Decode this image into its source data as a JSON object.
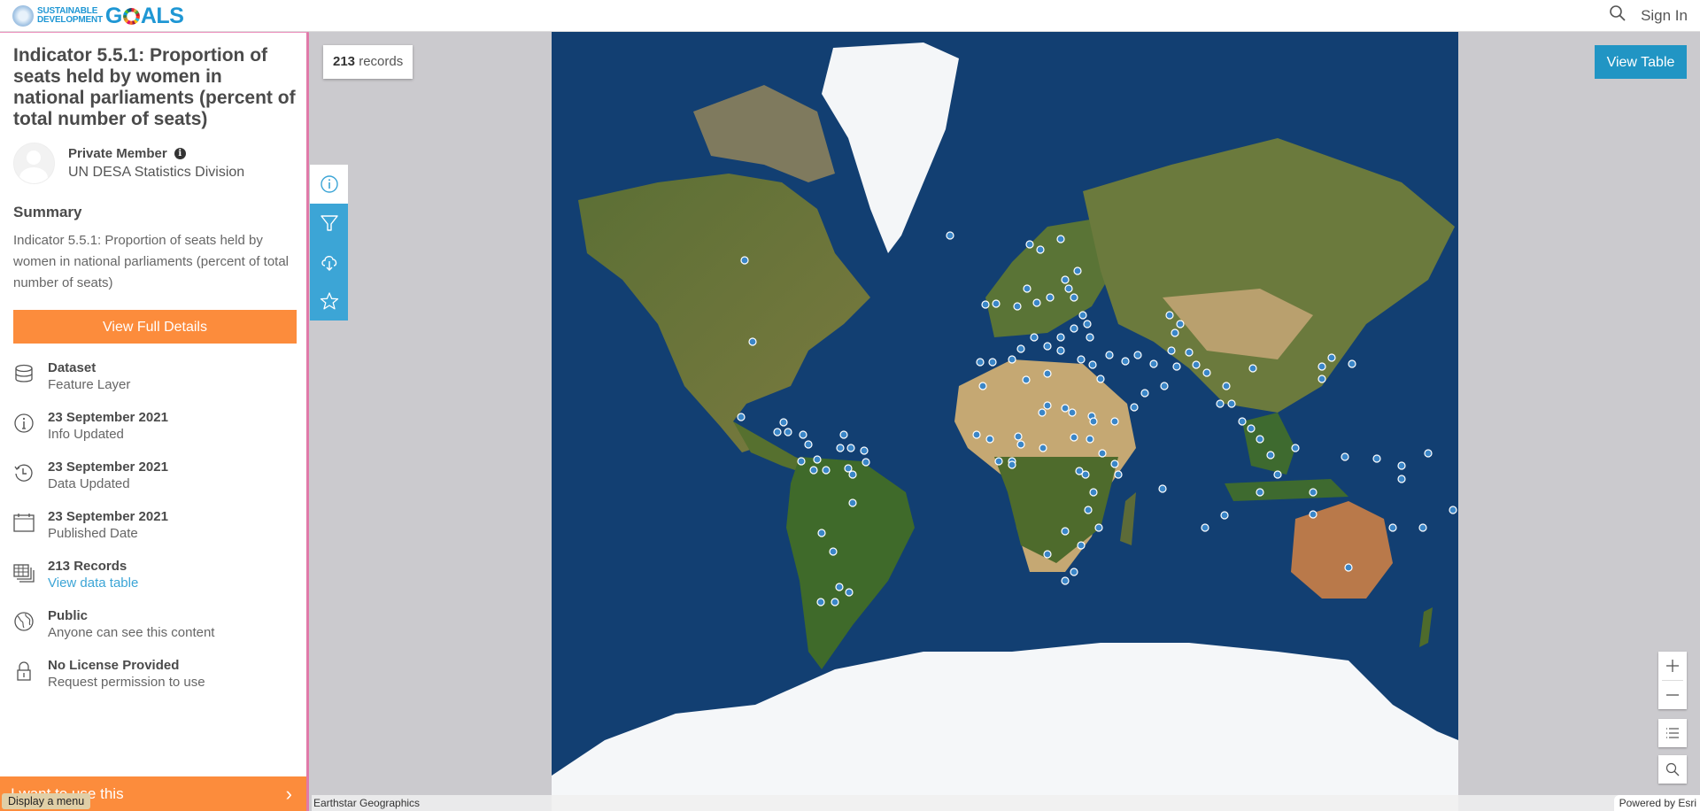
{
  "header": {
    "logo_small_line1": "SUSTAINABLE",
    "logo_small_line2": "DEVELOPMENT",
    "logo_goals_g": "G",
    "logo_goals_rest": "ALS",
    "search_icon": "search-icon",
    "sign_in": "Sign In"
  },
  "panel": {
    "title": "Indicator 5.5.1: Proportion of seats held by women in national parliaments (percent of total number of seats)",
    "owner_name": "Private Member",
    "owner_info_glyph": "i",
    "owner_org": "UN DESA Statistics Division",
    "summary_heading": "Summary",
    "summary_text": "Indicator 5.5.1: Proportion of seats held by women in national parliaments (percent of total number of seats)",
    "details_button": "View Full Details",
    "meta": [
      {
        "icon": "database-icon",
        "title": "Dataset",
        "sub": "Feature Layer"
      },
      {
        "icon": "info-icon",
        "title": "23 September 2021",
        "sub": "Info Updated"
      },
      {
        "icon": "history-icon",
        "title": "23 September 2021",
        "sub": "Data Updated"
      },
      {
        "icon": "calendar-icon",
        "title": "23 September 2021",
        "sub": "Published Date"
      },
      {
        "icon": "table-icon",
        "title": "213 Records",
        "link": "View data table"
      },
      {
        "icon": "globe-icon",
        "title": "Public",
        "sub": "Anyone can see this content"
      },
      {
        "icon": "lock-icon",
        "title": "No License Provided",
        "sub": "Request permission to use"
      }
    ],
    "bottom_bar": "I want to use this",
    "bottom_chevron": "›",
    "tooltip": "Display a menu"
  },
  "toolstrip": {
    "items": [
      "info-icon",
      "filter-icon",
      "download-icon",
      "favorite-icon"
    ],
    "active": "info-icon"
  },
  "map": {
    "records_count": "213",
    "records_label": " records",
    "view_table": "View Table",
    "zoom_in": "+",
    "zoom_out": "−",
    "legend_icon": "list-icon",
    "search_icon": "search-icon",
    "attribution": "Earthstar Geographics",
    "powered_by": "Powered by Esri",
    "colors": {
      "ocean": "#123f72",
      "point": "#3a86c8",
      "point_outline": "#ffffff"
    }
  }
}
